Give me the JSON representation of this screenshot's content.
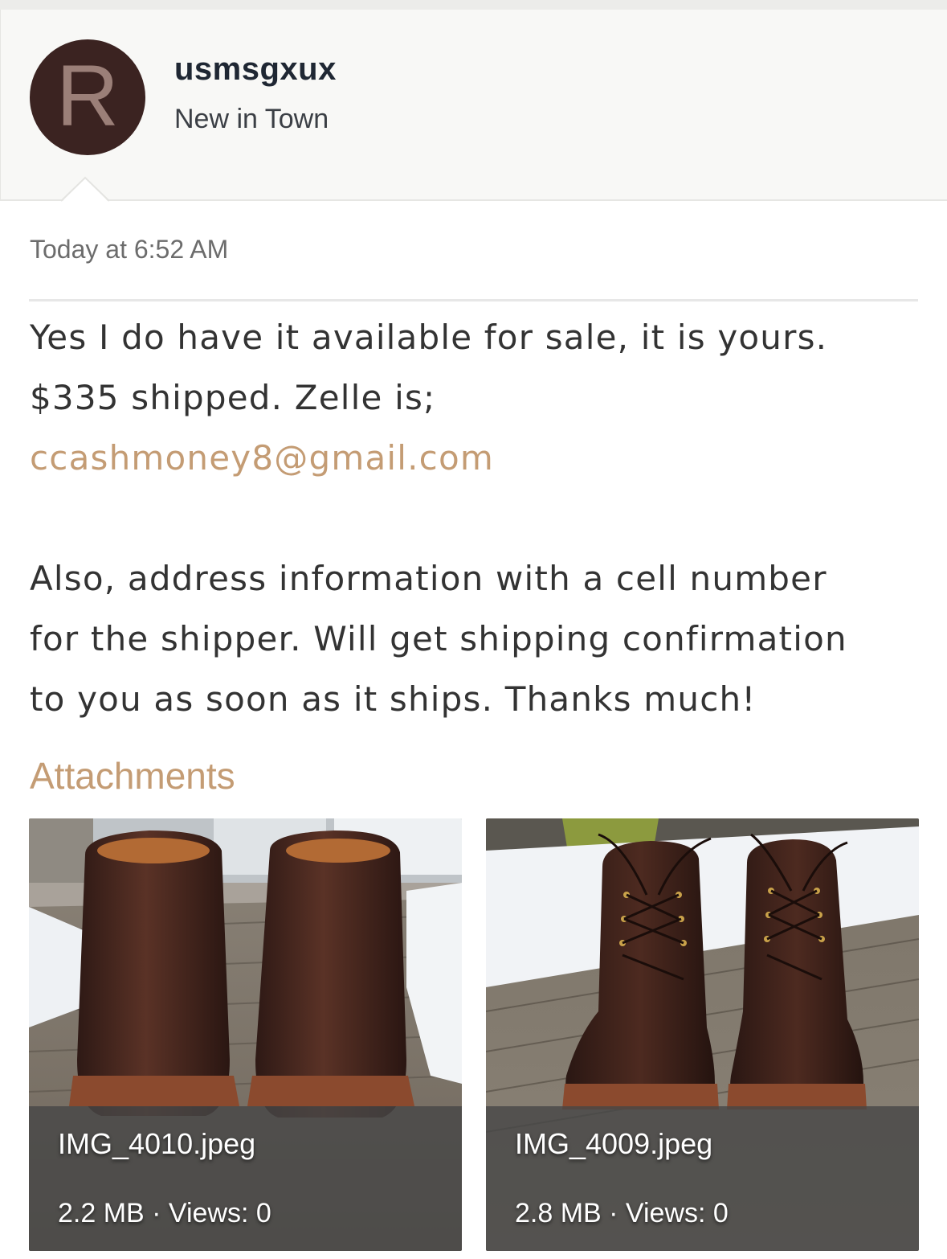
{
  "header": {
    "avatar_letter": "R",
    "username": "usmsgxux",
    "user_title": "New in Town"
  },
  "message": {
    "timestamp": "Today at 6:52 AM",
    "lines": [
      "Yes I do have it available for sale, it is yours.",
      "$335 shipped. Zelle is;"
    ],
    "email": "ccashmoney8@gmail.com",
    "lines2": [
      "Also, address information with a cell number",
      "for the shipper. Will get shipping confirmation",
      "to you as soon as it ships. Thanks much!"
    ]
  },
  "attachments": {
    "heading": "Attachments",
    "items": [
      {
        "filename": "IMG_4010.jpeg",
        "size": "2.2 MB",
        "views": "Views: 0",
        "meta": "2.2 MB · Views: 0",
        "image": "brown-boots-rear-view"
      },
      {
        "filename": "IMG_4009.jpeg",
        "size": "2.8 MB",
        "views": "Views: 0",
        "meta": "2.8 MB · Views: 0",
        "image": "brown-boots-front-view"
      }
    ]
  },
  "colors": {
    "accent": "#c49c74",
    "avatar_bg": "#3b2321",
    "avatar_letter": "#9b7f78",
    "username": "#1f2733",
    "body_text": "#333333"
  }
}
